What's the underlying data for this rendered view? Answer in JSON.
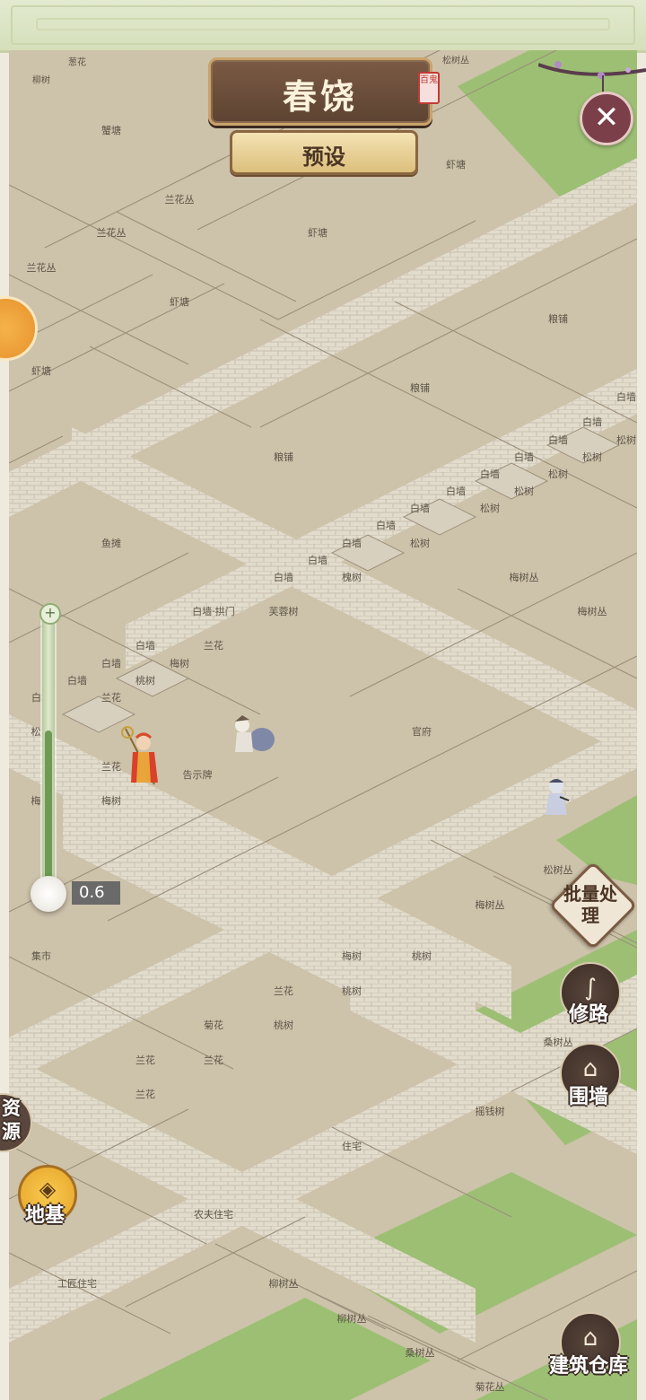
{
  "title": "春饶",
  "title_seal": "百鬼",
  "preset_label": "预设",
  "close_label": "✕",
  "zoom": {
    "plus": "+",
    "value": "0.6",
    "level": 0.6
  },
  "left_panel": {
    "resource_label": "资源",
    "foundation_label": "地基"
  },
  "right_panel": {
    "batch_label": "批量处理",
    "road_label": "修路",
    "wall_label": "围墙",
    "warehouse_label": "建筑仓库"
  },
  "map_labels": [
    "葱花",
    "柳树",
    "松树丛",
    "蟹塘",
    "虾塘",
    "兰花丛",
    "兰花丛",
    "兰花丛",
    "虾塘",
    "虾塘",
    "虾塘",
    "粮铺",
    "粮铺",
    "粮铺",
    "白墙",
    "白墙",
    "松树",
    "白墙",
    "松树",
    "白墙",
    "松树",
    "白墙",
    "白墙",
    "松树",
    "白墙",
    "松树",
    "白墙",
    "白墙",
    "松树",
    "白墙",
    "白墙",
    "槐树",
    "鱼摊",
    "梅树丛",
    "白墙·拱门",
    "芙蓉树",
    "梅树丛",
    "白墙",
    "兰花",
    "白墙",
    "梅树",
    "白墙",
    "桃树",
    "兰花",
    "白墙",
    "松",
    "兰花",
    "告示牌",
    "官府",
    "梅树",
    "梅",
    "松树丛",
    "梅树丛",
    "集市",
    "梅树",
    "桃树",
    "兰花",
    "桃树",
    "菊花",
    "桃树",
    "兰花",
    "兰花",
    "兰花",
    "桑树丛",
    "摇钱树",
    "住宅",
    "农夫住宅",
    "工匠住宅",
    "柳树丛",
    "柳树丛",
    "桑树丛",
    "菊花丛"
  ],
  "colors": {
    "ground": "#cdc2aa",
    "road": "#e3ddd0",
    "grass": "#9dbf74",
    "frame": "#d5dfba",
    "accent_brown": "#5d4332"
  }
}
